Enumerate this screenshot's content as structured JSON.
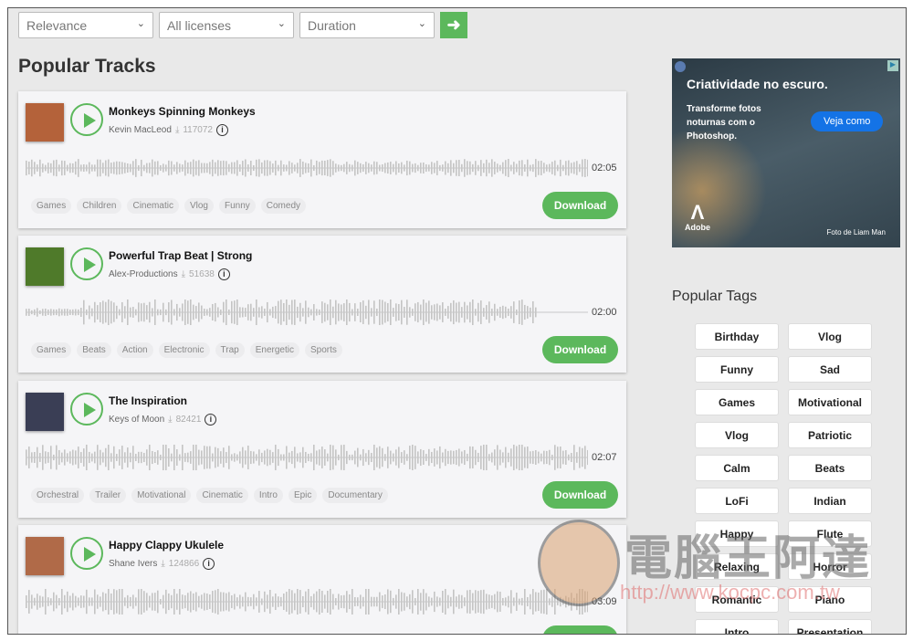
{
  "filters": {
    "sort": "Relevance",
    "license": "All licenses",
    "duration": "Duration",
    "go_icon": "arrow-right-icon"
  },
  "heading": "Popular Tracks",
  "tracks": [
    {
      "title": "Monkeys Spinning Monkeys",
      "artist": "Kevin MacLeod",
      "downloads": "117072",
      "duration": "02:05",
      "tags": [
        "Games",
        "Children",
        "Cinematic",
        "Vlog",
        "Funny",
        "Comedy"
      ],
      "download_label": "Download",
      "thumb_color": "#b4623a"
    },
    {
      "title": "Powerful Trap Beat | Strong",
      "artist": "Alex-Productions",
      "downloads": "51638",
      "duration": "02:00",
      "tags": [
        "Games",
        "Beats",
        "Action",
        "Electronic",
        "Trap",
        "Energetic",
        "Sports"
      ],
      "download_label": "Download",
      "thumb_color": "#4f7a2a"
    },
    {
      "title": "The Inspiration",
      "artist": "Keys of Moon",
      "downloads": "82421",
      "duration": "02:07",
      "tags": [
        "Orchestral",
        "Trailer",
        "Motivational",
        "Cinematic",
        "Intro",
        "Epic",
        "Documentary"
      ],
      "download_label": "Download",
      "thumb_color": "#3a3e55"
    },
    {
      "title": "Happy Clappy Ukulele",
      "artist": "Shane Ivers",
      "downloads": "124866",
      "duration": "03:09",
      "tags": [],
      "download_label": "Download",
      "thumb_color": "#b06a48"
    }
  ],
  "ad": {
    "headline": "Criatividade no escuro.",
    "body": "Transforme fotos noturnas com o Photoshop.",
    "cta": "Veja como",
    "brand": "Adobe",
    "credit": "Foto de Liam Man"
  },
  "popular_tags": {
    "heading": "Popular Tags",
    "items": [
      "Birthday",
      "Vlog",
      "Funny",
      "Sad",
      "Games",
      "Motivational",
      "Vlog",
      "Patriotic",
      "Calm",
      "Beats",
      "LoFi",
      "Indian",
      "Happy",
      "Flute",
      "Relaxing",
      "Horror",
      "Romantic",
      "Piano",
      "Intro",
      "Presentation"
    ]
  },
  "watermark": {
    "text": "電腦王阿達",
    "url": "http://www.kocpc.com.tw"
  },
  "colors": {
    "accent": "#5cb85c",
    "ad_cta": "#1473e6"
  }
}
